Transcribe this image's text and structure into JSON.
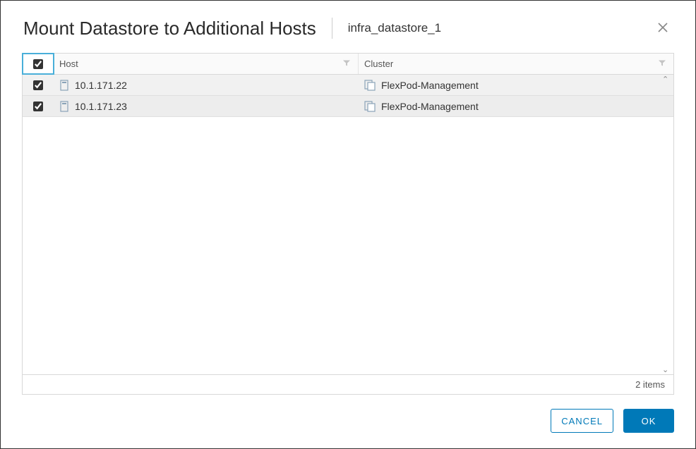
{
  "dialog": {
    "title": "Mount Datastore to Additional Hosts",
    "subtitle": "infra_datastore_1"
  },
  "columns": {
    "host": "Host",
    "cluster": "Cluster"
  },
  "rows": [
    {
      "host": "10.1.171.22",
      "cluster": "FlexPod-Management",
      "checked": true
    },
    {
      "host": "10.1.171.23",
      "cluster": "FlexPod-Management",
      "checked": true
    }
  ],
  "footer": {
    "count": "2 items"
  },
  "buttons": {
    "cancel": "CANCEL",
    "ok": "OK"
  }
}
